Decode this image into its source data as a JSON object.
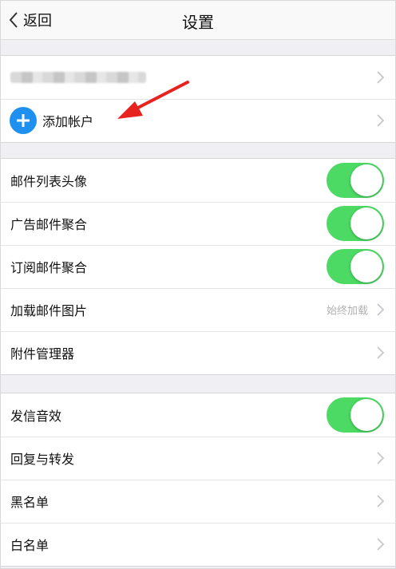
{
  "navbar": {
    "back_label": "返回",
    "title": "设置"
  },
  "accounts": {
    "add_account_label": "添加帐户"
  },
  "mail_settings": {
    "items": [
      {
        "label": "邮件列表头像",
        "toggle_on": true
      },
      {
        "label": "广告邮件聚合",
        "toggle_on": true
      },
      {
        "label": "订阅邮件聚合",
        "toggle_on": true
      },
      {
        "label": "加载邮件图片",
        "value": "始终加载"
      },
      {
        "label": "附件管理器"
      }
    ]
  },
  "other_settings": {
    "items": [
      {
        "label": "发信音效",
        "toggle_on": true
      },
      {
        "label": "回复与转发"
      },
      {
        "label": "黑名单"
      },
      {
        "label": "白名单"
      }
    ]
  },
  "colors": {
    "toggle_on": "#4cd964",
    "add_icon": "#1e90f0",
    "annotation_arrow": "#e8231f"
  },
  "icons": [
    "back-chevron-icon",
    "chevron-right-icon",
    "plus-icon",
    "annotation-arrow"
  ]
}
